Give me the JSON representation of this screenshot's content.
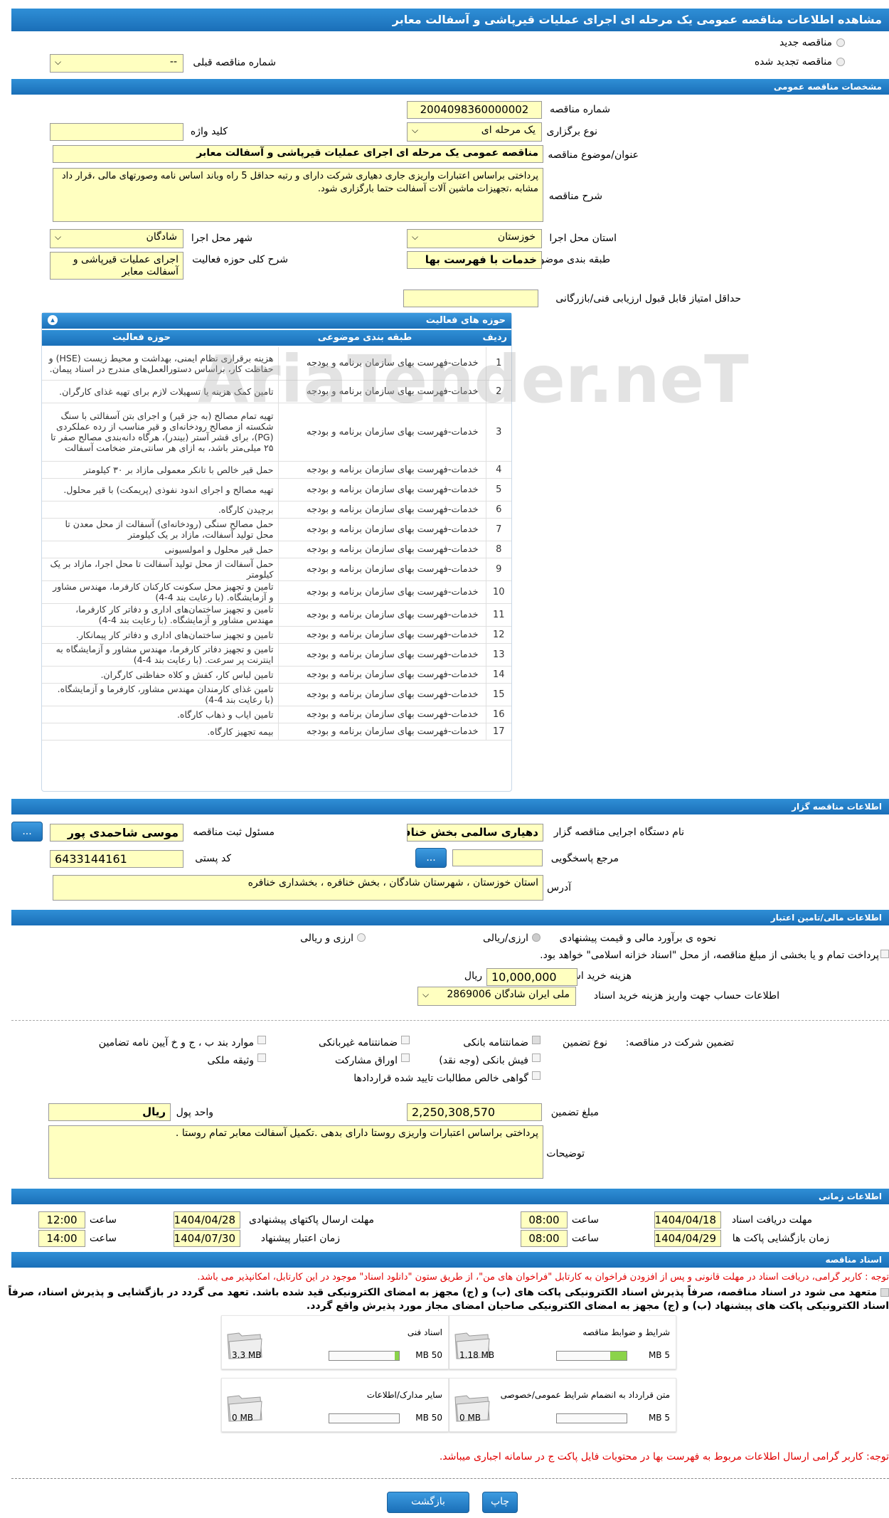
{
  "page_title": "مشاهده اطلاعات مناقصه عمومی یک مرحله ای اجرای عملیات قیرپاشی و آسفالت معابر",
  "type_choice": {
    "new_label": "مناقصه جدید",
    "renewed_label": "مناقصه تجدید شده",
    "prev_number_label": "شماره مناقصه قبلی",
    "prev_number_value": "--"
  },
  "general": {
    "header": "مشخصات مناقصه عمومی",
    "number_label": "شماره مناقصه",
    "number_value": "2004098360000002",
    "type_label": "نوع برگزاری",
    "type_value": "یک مرحله ای",
    "keyword_label": "کلید واژه",
    "keyword_value": "",
    "title_label": "عنوان/موضوع مناقصه",
    "title_value": "مناقصه عمومی یک مرحله ای اجرای عملیات قیرپاشی و آسفالت معابر",
    "desc_label": "شرح مناقصه",
    "desc_value": "پرداختی براساس اعتبارات واریزی جاری دهیاری شرکت دارای و  رتبه حداقل 5 راه وباند  اساس نامه وصورتهای مالی ،قرار داد مشابه ،تجهیزات ماشین آلات آسفالت حتما بارگزاری شود.",
    "province_label": "استان محل اجرا",
    "province_value": "خوزستان",
    "city_label": "شهر محل اجرا",
    "city_value": "شادگان",
    "category_label": "طبقه بندی موضوعی",
    "category_value": "خدمات با فهرست بها",
    "activity_desc_label": "شرح کلی حوزه فعالیت",
    "activity_desc_value": "اجرای عملیات قیرپاشی و آسفالت معابر",
    "min_score_label": "حداقل امتیاز قابل قبول ارزیابی فنی/بازرگانی",
    "min_score_value": ""
  },
  "activities": {
    "header": "حوزه های فعالیت",
    "col_row": "ردیف",
    "col_category": "طبقه بندی موضوعی",
    "col_activity": "حوزه فعالیت",
    "rows": [
      {
        "n": "1",
        "cat": "خدمات-فهرست بهای سازمان برنامه و بودجه",
        "act": "هزینه برقراری نظام ایمنی، بهداشت و محیط زیست (HSE) و حفاظت کار، براساس دستورالعمل‌های مندرج در اسناد پیمان."
      },
      {
        "n": "2",
        "cat": "خدمات-فهرست بهای سازمان برنامه و بودجه",
        "act": "تامین کمک هزینه یا تسهیلات لازم برای تهیه غذای کارگران."
      },
      {
        "n": "3",
        "cat": "خدمات-فهرست بهای سازمان برنامه و بودجه",
        "act": "تهیه تمام مصالح (به جز قیر) و اجرای بتن آسفالتی با سنگ شکسته از مصالح رودخانه‌ای و قیر مناسب از رده عملکردی (PG)، برای قشر آستر (بیندر)، هرگاه دانه‌بندی مصالح صفر تا ۲۵ میلی‌متر باشد، به ازای هر سانتی‌متر ضخامت آسفالت"
      },
      {
        "n": "4",
        "cat": "خدمات-فهرست بهای سازمان برنامه و بودجه",
        "act": " حمل قیر خالص با تانکر معمولی مازاد بر ۳۰ کیلومتر"
      },
      {
        "n": "5",
        "cat": "خدمات-فهرست بهای سازمان برنامه و بودجه",
        "act": "تهیه مصالح و اجرای اندود نفوذی (پریمکت) با قیر محلول."
      },
      {
        "n": "6",
        "cat": "خدمات-فهرست بهای سازمان برنامه و بودجه",
        "act": "برچیدن کارگاه."
      },
      {
        "n": "7",
        "cat": "خدمات-فهرست بهای سازمان برنامه و بودجه",
        "act": "حمل مصالح سنگی (رودخانه‌ای) آسفالت از محل معدن تا محل تولید آسفالت، مازاد بر یک کیلومتر"
      },
      {
        "n": "8",
        "cat": "خدمات-فهرست بهای سازمان برنامه و بودجه",
        "act": "حمل قیر محلول و امولسیونی"
      },
      {
        "n": "9",
        "cat": "خدمات-فهرست بهای سازمان برنامه و بودجه",
        "act": "حمل آسفالت از محل تولید آسفالت تا محل اجرا، مازاد بر یک کیلومتر"
      },
      {
        "n": "10",
        "cat": "خدمات-فهرست بهای سازمان برنامه و بودجه",
        "act": "تامین و تجهیز محل سکونت کارکنان کارفرما، مهندس مشاور و آزمایشگاه. (با رعایت بند 4-4)"
      },
      {
        "n": "11",
        "cat": "خدمات-فهرست بهای سازمان برنامه و بودجه",
        "act": "تامین و تجهیز ساختمان‌های اداری و دفاتر کار کارفرما، مهندس مشاور و آزمایشگاه. (با رعایت بند 4-4)"
      },
      {
        "n": "12",
        "cat": "خدمات-فهرست بهای سازمان برنامه و بودجه",
        "act": "تامین و تجهیز ساختمان‌های اداری و دفاتر کار پیمانکار."
      },
      {
        "n": "13",
        "cat": "خدمات-فهرست بهای سازمان برنامه و بودجه",
        "act": "تامین و تجهیز دفاتر کارفرما، مهندس مشاور و آزمایشگاه به اینترنت پر سرعت. (با رعایت بند 4-4)"
      },
      {
        "n": "14",
        "cat": "خدمات-فهرست بهای سازمان برنامه و بودجه",
        "act": "تامین لباس کار، کفش و کلاه حفاظتی کارگران."
      },
      {
        "n": "15",
        "cat": "خدمات-فهرست بهای سازمان برنامه و بودجه",
        "act": "تامین غذای کارمندان مهندس مشاور، کارفرما و آزمایشگاه. (با رعایت بند 4-4)"
      },
      {
        "n": "16",
        "cat": "خدمات-فهرست بهای سازمان برنامه و بودجه",
        "act": "تامین ایاب و ذهاب کارگاه."
      },
      {
        "n": "17",
        "cat": "خدمات-فهرست بهای سازمان برنامه و بودجه",
        "act": "بیمه تجهیز کارگاه."
      }
    ]
  },
  "organizer": {
    "header": "اطلاعات مناقصه گزار",
    "org_label": "نام دستگاه اجرایی مناقصه گزار",
    "org_value": "دهیاری سالمی بخش خنافره",
    "resp_label": "مسئول ثبت مناقصه",
    "resp_value": "موسی شاحمدی پور",
    "ref_label": "مرجع پاسخگویی",
    "ref_value": "",
    "postal_label": "کد پستی",
    "postal_value": "6433144161",
    "address_label": "آدرس",
    "address_value": "استان خوزستان ، شهرستان شادگان ، بخش خنافره ، بخشداری خنافره",
    "dots": "..."
  },
  "finance": {
    "header": "اطلاعات مالی/تامین اعتبار",
    "estimate_label": "نحوه ی برآورد مالی و قیمت پیشنهادی",
    "opt_rial": "ارزی/ریالی",
    "opt_both": "ارزی و ریالی",
    "islamic_note": "پرداخت تمام و یا بخشی از مبلغ مناقصه، از محل \"اسناد خزانه اسلامی\" خواهد بود.",
    "doc_fee_label": "هزینه خرید اسناد",
    "doc_fee_value": "10,000,000",
    "rial": "ریال",
    "account_label": "اطلاعات حساب جهت واریز هزینه خرید اسناد",
    "account_value": "ملی ایران شادگان 2869006"
  },
  "guarantee": {
    "participation_label": "تضمین شرکت در مناقصه:",
    "type_label": "نوع تضمین",
    "opt_bank": "ضمانتنامه بانکی",
    "opt_nonbank": "ضمانتنامه غیربانکی",
    "opt_cases": "موارد بند ب ، ج و خ آیین نامه تضامین",
    "opt_cheque": "فیش بانکی (وجه نقد)",
    "opt_bonds": "اوراق مشارکت",
    "opt_property": "وثیقه ملکی",
    "opt_claims": "گواهی خالص مطالبات تایید شده قراردادها",
    "amount_label": "مبلغ تضمین",
    "amount_value": "2,250,308,570",
    "currency_label": "واحد پول",
    "currency_value": "ریال",
    "notes_label": "توضیحات",
    "notes_value": "پرداختی براساس اعتبارات واریزی روستا دارای بدهی .تکمیل آسفالت معابر تمام روستا ."
  },
  "timing": {
    "header": "اطلاعات زمانی",
    "receive_label": "مهلت دریافت اسناد",
    "receive_date": "1404/04/18",
    "receive_time": "08:00",
    "send_label": "مهلت ارسال پاکتهای پیشنهادی",
    "send_date": "1404/04/28",
    "send_time": "12:00",
    "open_label": "زمان بازگشایی پاکت ها",
    "open_date": "1404/04/29",
    "open_time": "08:00",
    "valid_label": "زمان اعتبار پیشنهاد",
    "valid_date": "1404/07/30",
    "valid_time": "14:00",
    "time_label": "ساعت"
  },
  "documents": {
    "header": "اسناد مناقصه",
    "notice": "توجه : کاربر گرامی، دریافت اسناد در مهلت قانونی و پس از افزودن فراخوان به کارتابل \"فراخوان های من\"، از طریق ستون \"دانلود اسناد\" موجود در این کارتابل، امکانپذیر می باشد.",
    "commit": "متعهد می شود در اسناد مناقصه، صرفاً پذیرش اسناد الکترونیکی پاکت های (ب) و (ج) مجهز به امضای الکترونیکی قید شده باشد. تعهد می گردد در بازگشایی و پذیرش اسناد، صرفاً اسناد الکترونیکی پاکت های پیشنهاد (ب) و (ج) مجهز به امضای الکترونیکی صاحبان امضای مجاز مورد پذیرش واقع گردد.",
    "cards": [
      {
        "title": "شرایط و ضوابط مناقصه",
        "used": "1.18 MB",
        "max": "5 MB",
        "fill": 0.236
      },
      {
        "title": "اسناد فنی",
        "used": "3.3 MB",
        "max": "50 MB",
        "fill": 0.066
      },
      {
        "title": "متن قرارداد به انضمام شرایط عمومی/خصوصی",
        "used": "0 MB",
        "max": "5 MB",
        "fill": 0
      },
      {
        "title": "سایر مدارک/اطلاعات",
        "used": "0 MB",
        "max": "50 MB",
        "fill": 0
      }
    ],
    "footer_notice": "توجه: کاربر گرامی ارسال اطلاعات مربوط به فهرست بها در محتویات فایل پاکت ج در سامانه اجباری میباشد."
  },
  "buttons": {
    "print": "چاپ",
    "back": "بازگشت"
  },
  "watermark": "AriaTender.neT",
  "colors": {
    "header_blue": "#1f78c1",
    "input_yellow": "#ffffc0",
    "notice_red": "#e00000"
  }
}
